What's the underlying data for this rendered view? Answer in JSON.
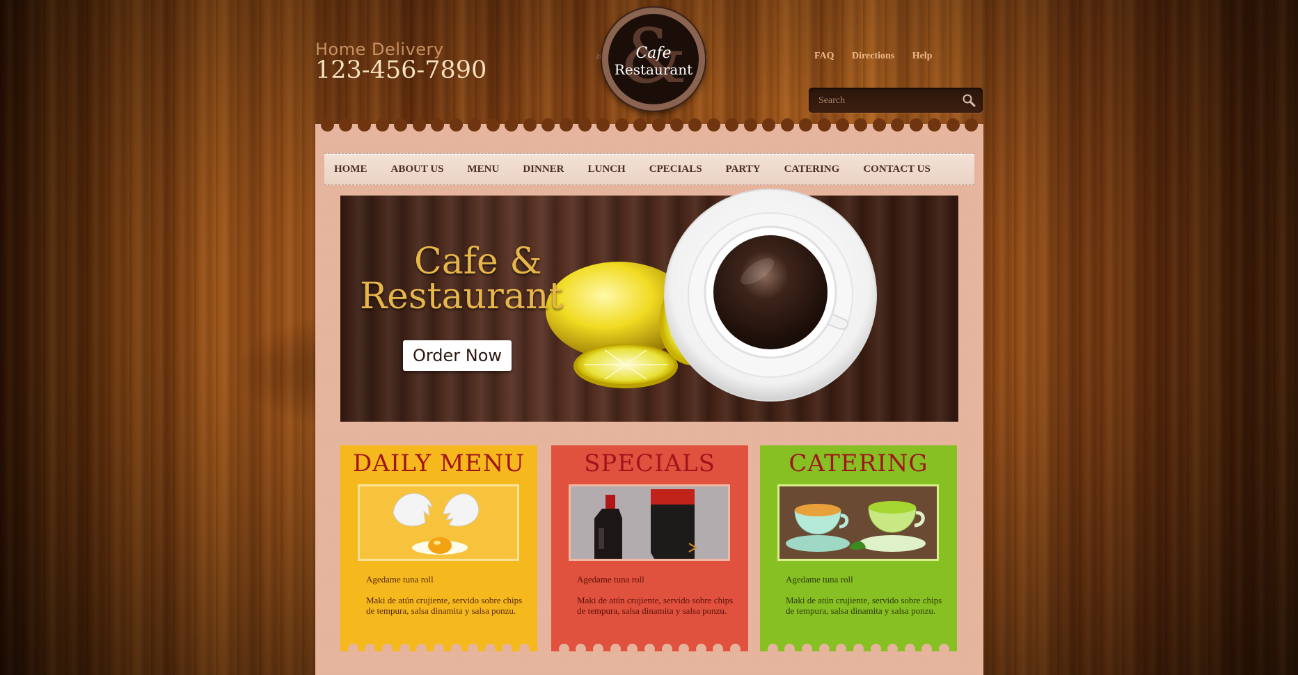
{
  "header": {
    "delivery_label": "Home Delivery",
    "phone": "123-456-7890",
    "logo": {
      "symbol": "&",
      "line1": "Cafe",
      "line2": "Restaurant"
    },
    "links": [
      "FAQ",
      "Directions",
      "Help"
    ],
    "search_placeholder": "Search",
    "search_icon": "magnifier-icon"
  },
  "nav": {
    "items": [
      "HOME",
      "ABOUT US",
      "MENU",
      "DINNER",
      "LUNCH",
      "CPECIALS",
      "PARTY",
      "CATERING",
      "CONTACT US"
    ]
  },
  "banner": {
    "title_line1": "Cafe &",
    "title_line2": "Restaurant",
    "button_label": "Order Now"
  },
  "cards": [
    {
      "title": "DAILY MENU",
      "item_name": "Agedame tuna roll",
      "description": "Maki de atún crujiente, servido sobre chips de tempura, salsa dinamita y salsa ponzu.",
      "image": "broken-egg",
      "color": "#f5b81d"
    },
    {
      "title": "SPECIALS",
      "item_name": "Agedame tuna roll",
      "description": "Maki de atún crujiente, servido sobre chips de tempura, salsa dinamita y salsa ponzu.",
      "image": "sauce-bottle-and-box",
      "color": "#e0513e"
    },
    {
      "title": "CATERING",
      "item_name": "Agedame tuna roll",
      "description": "Maki de atún crujiente, servido sobre chips de tempura, salsa dinamita y salsa ponzu.",
      "image": "tea-cups",
      "color": "#86c022"
    }
  ]
}
